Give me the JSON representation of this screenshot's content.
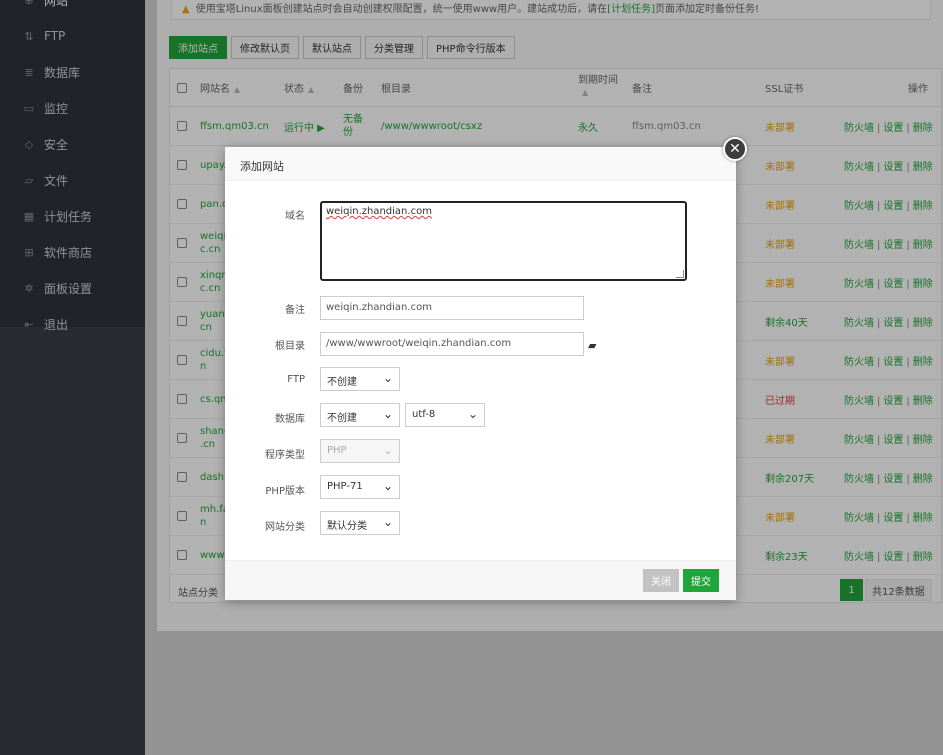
{
  "sidebar": {
    "items": [
      {
        "label": "网站",
        "icon": "globe-icon",
        "glyph": "⊕"
      },
      {
        "label": "FTP",
        "icon": "ftp-icon",
        "glyph": "⇅"
      },
      {
        "label": "数据库",
        "icon": "database-icon",
        "glyph": "≣"
      },
      {
        "label": "监控",
        "icon": "monitor-icon",
        "glyph": "▭"
      },
      {
        "label": "安全",
        "icon": "shield-icon",
        "glyph": "◇"
      },
      {
        "label": "文件",
        "icon": "folder-icon",
        "glyph": "▱"
      },
      {
        "label": "计划任务",
        "icon": "calendar-icon",
        "glyph": "▦"
      },
      {
        "label": "软件商店",
        "icon": "grid-icon",
        "glyph": "⊞"
      },
      {
        "label": "面板设置",
        "icon": "gear-icon",
        "glyph": "✲"
      },
      {
        "label": "退出",
        "icon": "logout-icon",
        "glyph": "⇤"
      }
    ]
  },
  "notice": {
    "text_before": "使用宝塔Linux面板创建站点时会自动创建权限配置，统一使用www用户。建站成功后，请在",
    "link": "[计划任务]",
    "text_after": "页面添加定时备份任务!"
  },
  "toolbar": {
    "buttons": [
      "添加站点",
      "修改默认页",
      "默认站点",
      "分类管理",
      "PHP命令行版本"
    ]
  },
  "table": {
    "headers": {
      "name": "网站名",
      "status": "状态",
      "backup": "备份",
      "root": "根目录",
      "expire": "到期时间",
      "note": "备注",
      "ssl": "SSL证书",
      "ops": "操作"
    },
    "first_row": {
      "name": "ffsm.qm03.cn",
      "status": "运行中 ▶",
      "backup": "无备份",
      "root": "/www/wwwroot/csxz",
      "expire": "永久",
      "note": "ffsm.qm03.cn"
    },
    "rows": [
      {
        "name": "ffsm.qm03.cn",
        "ssl": "未部署",
        "ssl_state": "orange"
      },
      {
        "name": "upay.",
        "ssl": "未部署",
        "ssl_state": "orange"
      },
      {
        "name": "pan.q",
        "ssl": "未部署",
        "ssl_state": "orange"
      },
      {
        "name": "weiqi\nc.cn",
        "ssl": "未部署",
        "ssl_state": "orange"
      },
      {
        "name": "xinqn\nc.cn",
        "ssl": "未部署",
        "ssl_state": "orange"
      },
      {
        "name": "yuan\ncn",
        "ssl": "剩余40天",
        "ssl_state": "green"
      },
      {
        "name": "cidu.f\nn",
        "ssl": "未部署",
        "ssl_state": "orange"
      },
      {
        "name": "cs.qm",
        "ssl": "已过期",
        "ssl_state": "red"
      },
      {
        "name": "shang\n.cn",
        "ssl": "未部署",
        "ssl_state": "orange"
      },
      {
        "name": "dashi",
        "ssl": "剩余207天",
        "ssl_state": "green"
      },
      {
        "name": "mh.fa\nn",
        "ssl": "未部署",
        "ssl_state": "orange"
      },
      {
        "name": "www.",
        "ssl": "剩余23天",
        "ssl_state": "green"
      }
    ],
    "ops": {
      "firewall": "防火墙",
      "sep": "|",
      "settings": "设置",
      "delete": "删除"
    },
    "footer": {
      "category_label": "站点分类",
      "page": "1",
      "total": "共12条数据"
    }
  },
  "dialog": {
    "title": "添加网站",
    "fields": {
      "domain_label": "域名",
      "domain_value": "weiqin.zhandian.com",
      "note_label": "备注",
      "note_value": "weiqin.zhandian.com",
      "root_label": "根目录",
      "root_value": "/www/wwwroot/weiqin.zhandian.com",
      "ftp_label": "FTP",
      "ftp_value": "不创建",
      "db_label": "数据库",
      "db_value": "不创建",
      "charset_value": "utf-8",
      "program_label": "程序类型",
      "program_value": "PHP",
      "php_label": "PHP版本",
      "php_value": "PHP-71",
      "category_label": "网站分类",
      "category_value": "默认分类"
    },
    "buttons": {
      "close": "关闭",
      "submit": "提交"
    }
  },
  "colors": {
    "accent": "#20a53a",
    "sidebar_bg": "#3a3f48",
    "warning": "#e8a20f",
    "danger": "#e03a3a"
  }
}
